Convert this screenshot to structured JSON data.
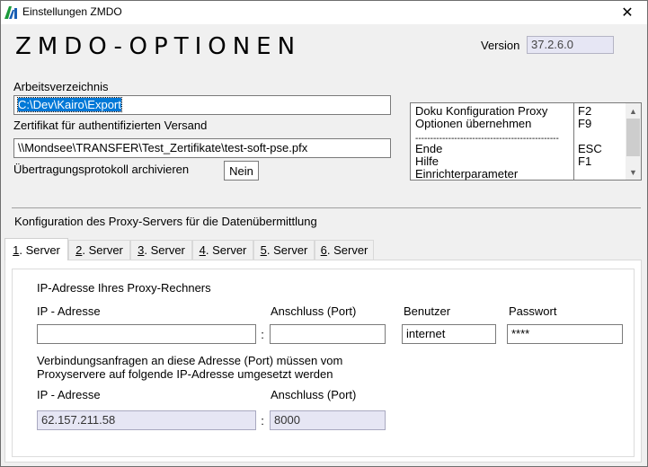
{
  "window": {
    "title": "Einstellungen ZMDO",
    "app_icon": "app-logo-icon",
    "close_glyph": "✕"
  },
  "header": {
    "big_title": "ZMDO-OPTIONEN",
    "version_label": "Version",
    "version_value": "37.2.6.0"
  },
  "settings": {
    "workdir_label": "Arbeitsverzeichnis",
    "workdir_value": "C:\\Dev\\Kairo\\Export",
    "cert_label": "Zertifikat für authentifizierten Versand",
    "cert_value": "\\\\Mondsee\\TRANSFER\\Test_Zertifikate\\test-soft-pse.pfx",
    "protocol_label": "Übertragungsprotokoll archivieren",
    "protocol_value": "Nein"
  },
  "shortcuts": {
    "items": [
      {
        "label": "Doku Konfiguration Proxy",
        "key": "F2"
      },
      {
        "label": "Optionen übernehmen",
        "key": "F9"
      },
      {
        "label": "Ende",
        "key": "ESC"
      },
      {
        "label": "Hilfe",
        "key": "F1"
      },
      {
        "label": "Einrichterparameter",
        "key": ""
      }
    ],
    "separator": "------------------------------------------------"
  },
  "proxy": {
    "section_title": "Konfiguration des Proxy-Servers für die Datenübermittlung",
    "tabs": [
      {
        "num": "1",
        "label": ". Server"
      },
      {
        "num": "2",
        "label": ". Server"
      },
      {
        "num": "3",
        "label": ". Server"
      },
      {
        "num": "4",
        "label": ". Server"
      },
      {
        "num": "5",
        "label": ". Server"
      },
      {
        "num": "6",
        "label": ". Server"
      }
    ],
    "group_title": "IP-Adresse Ihres Proxy-Rechners",
    "ip_label": "IP - Adresse",
    "port_label": "Anschluss (Port)",
    "user_label": "Benutzer",
    "password_label": "Passwort",
    "ip_value": "",
    "port_value": "",
    "user_value": "internet",
    "password_value": "****",
    "colon": ":",
    "info_line1": "Verbindungsanfragen an diese Adresse (Port) müssen vom",
    "info_line2": "Proxyservere auf folgende IP-Adresse umgesetzt werden",
    "ip2_label": "IP - Adresse",
    "port2_label": "Anschluss (Port)",
    "ip2_value": "62.157.211.58",
    "port2_value": "8000"
  }
}
